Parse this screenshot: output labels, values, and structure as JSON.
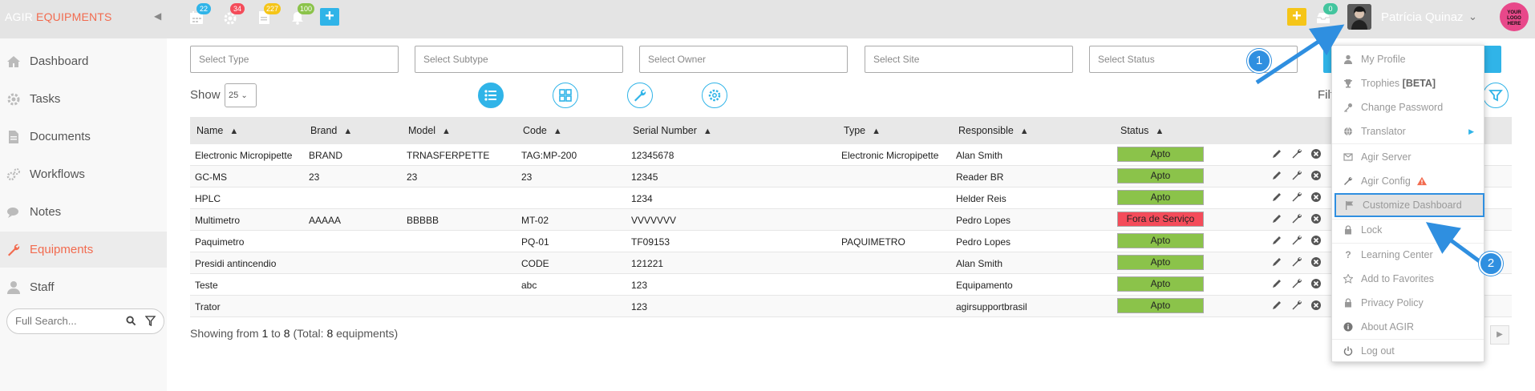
{
  "header": {
    "brand": "AGIR",
    "module": "EQUIPMENTS",
    "badges": {
      "calendar": "22",
      "gear": "34",
      "docs": "227",
      "bell": "100",
      "inbox": "0"
    },
    "user_name": "Patrícia Quinaz",
    "logo_text": "YOUR LOGO HERE"
  },
  "sidebar": {
    "items": [
      {
        "label": "Dashboard",
        "icon": "home-icon"
      },
      {
        "label": "Tasks",
        "icon": "gear-icon"
      },
      {
        "label": "Documents",
        "icon": "document-icon"
      },
      {
        "label": "Workflows",
        "icon": "gears-icon"
      },
      {
        "label": "Notes",
        "icon": "comments-icon"
      },
      {
        "label": "Equipments",
        "icon": "wrench-icon"
      },
      {
        "label": "Staff",
        "icon": "user-icon"
      }
    ],
    "search_placeholder": "Full Search..."
  },
  "filters": {
    "type": "Select Type",
    "subtype": "Select Subtype",
    "owner": "Select Owner",
    "site": "Select Site",
    "status": "Select Status"
  },
  "controls": {
    "show_label": "Show",
    "page_size": "25",
    "filter_label": "Filt"
  },
  "table": {
    "columns": [
      "Name",
      "Brand",
      "Model",
      "Code",
      "Serial Number",
      "Type",
      "Responsible",
      "Status"
    ],
    "rows": [
      {
        "name": "Electronic Micropipette",
        "brand": "BRAND",
        "model": "TRNASFERPETTE",
        "code": "TAG:MP-200",
        "serial": "12345678",
        "type": "Electronic Micropipette",
        "responsible": "Alan Smith",
        "status": "Apto"
      },
      {
        "name": "GC-MS",
        "brand": "23",
        "model": "23",
        "code": "23",
        "serial": "12345",
        "type": "",
        "responsible": "Reader BR",
        "status": "Apto"
      },
      {
        "name": "HPLC",
        "brand": "",
        "model": "",
        "code": "",
        "serial": "1234",
        "type": "",
        "responsible": "Helder Reis",
        "status": "Apto"
      },
      {
        "name": "Multimetro",
        "brand": "AAAAA",
        "model": "BBBBB",
        "code": "MT-02",
        "serial": "VVVVVVV",
        "type": "",
        "responsible": "Pedro Lopes",
        "status": "Fora de Serviço"
      },
      {
        "name": "Paquimetro",
        "brand": "",
        "model": "",
        "code": "PQ-01",
        "serial": "TF09153",
        "type": "PAQUIMETRO",
        "responsible": "Pedro Lopes",
        "status": "Apto"
      },
      {
        "name": "Presidi antincendio",
        "brand": "",
        "model": "",
        "code": "CODE",
        "serial": "121221",
        "type": "",
        "responsible": "Alan Smith",
        "status": "Apto"
      },
      {
        "name": "Teste",
        "brand": "",
        "model": "",
        "code": "abc",
        "serial": "123",
        "type": "",
        "responsible": "Equipamento",
        "status": "Apto"
      },
      {
        "name": "Trator",
        "brand": "",
        "model": "",
        "code": "",
        "serial": "123",
        "type": "",
        "responsible": "agirsupportbrasil",
        "status": "Apto"
      }
    ],
    "status_colors": {
      "Apto": "#8bc34a",
      "Fora de Serviço": "#f44c5a"
    }
  },
  "footer": {
    "showing_prefix": "Showing from",
    "from": "1",
    "to_word": "to",
    "to": "8",
    "total_prefix": "(Total:",
    "total": "8",
    "total_suffix": "equipments)"
  },
  "user_menu": {
    "items": [
      {
        "label": "My Profile",
        "icon": "user-icon"
      },
      {
        "label": "Trophies",
        "extra": "[BETA]",
        "icon": "trophy-icon"
      },
      {
        "label": "Change Password",
        "icon": "key-icon"
      },
      {
        "label": "Translator",
        "icon": "globe-icon"
      },
      {
        "label": "Agir Server",
        "icon": "server-icon"
      },
      {
        "label": "Agir Config",
        "icon": "wrench-icon"
      },
      {
        "label": "Customize Dashboard",
        "icon": "flag-icon"
      },
      {
        "label": "Lock",
        "icon": "lock-icon"
      },
      {
        "label": "Learning Center",
        "icon": "question-icon"
      },
      {
        "label": "Add to Favorites",
        "icon": "star-icon"
      },
      {
        "label": "Privacy Policy",
        "icon": "lock-icon"
      },
      {
        "label": "About AGIR",
        "icon": "info-icon"
      },
      {
        "label": "Log out",
        "icon": "power-icon"
      }
    ]
  },
  "callouts": [
    "1",
    "2"
  ],
  "colors": {
    "accent": "#f26b4f",
    "blue": "#30b4e8",
    "callout": "#2f8fe0",
    "yellow": "#f5c518"
  }
}
